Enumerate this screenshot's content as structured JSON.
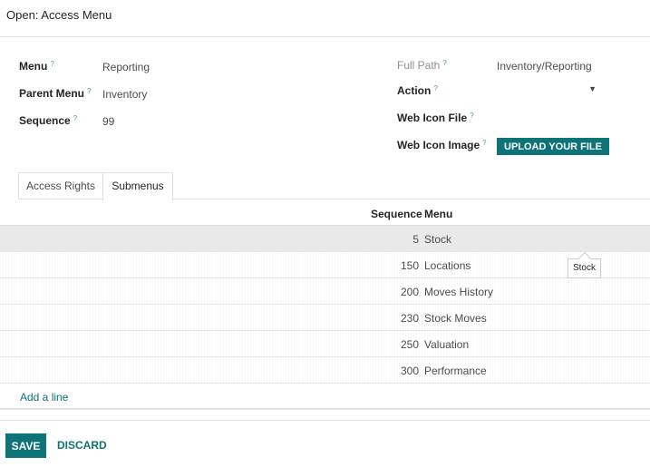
{
  "dialog": {
    "title": "Open: Access Menu"
  },
  "form": {
    "menu": {
      "label": "Menu",
      "help": "?",
      "value": "Reporting"
    },
    "parent_menu": {
      "label": "Parent Menu",
      "help": "?",
      "value": "Inventory"
    },
    "sequence": {
      "label": "Sequence",
      "help": "?",
      "value": "99"
    },
    "full_path": {
      "label": "Full Path",
      "help": "?",
      "value": "Inventory/Reporting"
    },
    "action": {
      "label": "Action",
      "help": "?",
      "value": ""
    },
    "web_icon_file": {
      "label": "Web Icon File",
      "help": "?"
    },
    "web_icon_image": {
      "label": "Web Icon Image",
      "help": "?",
      "button_label": "UPLOAD YOUR FILE"
    }
  },
  "tabs": [
    {
      "label": "Access Rights",
      "active": false
    },
    {
      "label": "Submenus",
      "active": true
    }
  ],
  "submenus": {
    "columns": {
      "sequence": "Sequence",
      "menu": "Menu"
    },
    "rows": [
      {
        "sequence": "5",
        "menu": "Stock"
      },
      {
        "sequence": "150",
        "menu": "Locations"
      },
      {
        "sequence": "200",
        "menu": "Moves History"
      },
      {
        "sequence": "230",
        "menu": "Stock Moves"
      },
      {
        "sequence": "250",
        "menu": "Valuation"
      },
      {
        "sequence": "300",
        "menu": "Performance"
      }
    ],
    "add_line": "Add a line"
  },
  "tooltip": {
    "text": "Stock"
  },
  "footer": {
    "save": "SAVE",
    "discard": "DISCARD"
  },
  "colors": {
    "accent": "#0d7377",
    "hover_row": "#e9e9e9"
  },
  "icons": {
    "action_dropdown": "caret-down-icon"
  }
}
